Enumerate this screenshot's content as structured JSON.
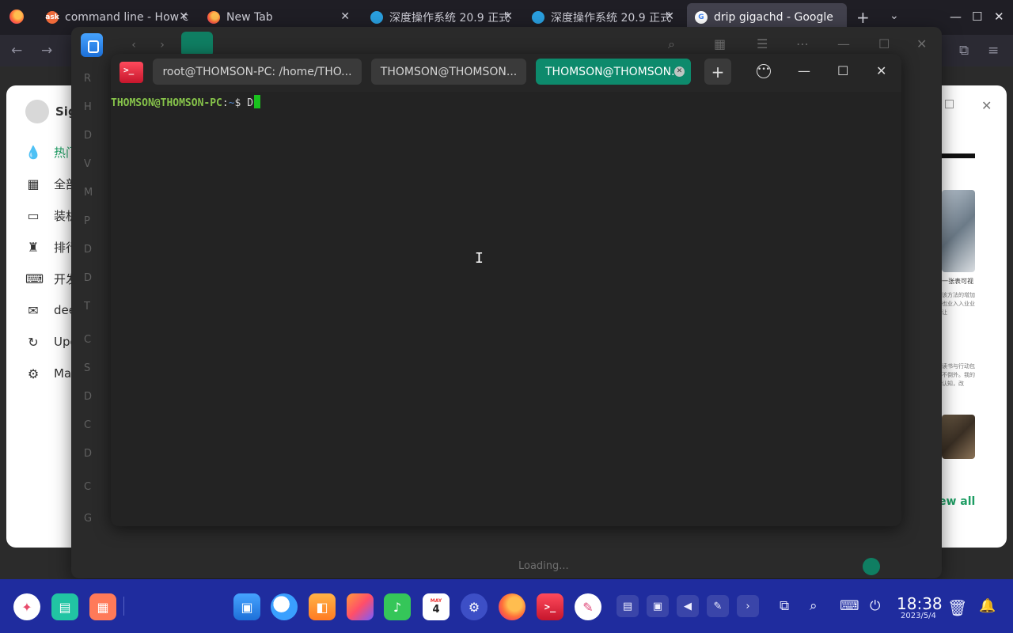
{
  "browser": {
    "tabs": [
      {
        "label": "command line - How c",
        "favicon": "ask",
        "active": false
      },
      {
        "label": "New Tab",
        "favicon": "firefox",
        "active": false
      },
      {
        "label": "深度操作系统 20.9 正式",
        "favicon": "deepin",
        "active": false
      },
      {
        "label": "深度操作系统 20.9 正式",
        "favicon": "deepin",
        "active": false
      },
      {
        "label": "drip gigachd - Google",
        "favicon": "google",
        "active": true
      }
    ],
    "ask_favicon_text": "ask",
    "google_favicon_text": "G",
    "icons": {
      "new_tab": "plus-icon",
      "list_tabs": "chevron-down-icon",
      "back": "arrow-left-icon",
      "forward": "arrow-right-icon",
      "extensions": "puzzle-icon",
      "menu": "hamburger-icon"
    }
  },
  "background_page": {
    "sign_in_label": "Sig",
    "sidebar": [
      {
        "label": "热门",
        "icon": "flame-icon",
        "highlighted": true
      },
      {
        "label": "全部",
        "icon": "grid-icon",
        "highlighted": false
      },
      {
        "label": "装机",
        "icon": "monitor-icon",
        "highlighted": false
      },
      {
        "label": "排行",
        "icon": "trophy-icon",
        "highlighted": false
      },
      {
        "label": "开发",
        "icon": "terminal-icon",
        "highlighted": false
      },
      {
        "label": "dee",
        "icon": "chat-icon",
        "highlighted": false
      },
      {
        "label": "Upd",
        "icon": "refresh-icon",
        "highlighted": false
      },
      {
        "label": "Ma",
        "icon": "gear-icon",
        "highlighted": false
      }
    ],
    "right_texts": [
      "一张表可视",
      "该方法的增加也业入入业业让",
      "读书与行动包不倒外。我的认知，改"
    ],
    "view_all": "ew all"
  },
  "file_manager": {
    "sidebar_letters": [
      "R",
      "H",
      "D",
      "V",
      "M",
      "P",
      "D",
      "D",
      "T",
      "C",
      "S",
      "D",
      "C",
      "D",
      "C",
      "G"
    ],
    "loading_text": "Loading..."
  },
  "terminal": {
    "tabs": [
      {
        "label": "root@THOMSON-PC: /home/THO...",
        "active": false
      },
      {
        "label": "THOMSON@THOMSON...",
        "active": false
      },
      {
        "label": "THOMSON@THOMSON...",
        "active": true
      }
    ],
    "prompt_user": "THOMSON@THOMSON-PC",
    "prompt_sep": ":",
    "prompt_path": "~",
    "prompt_symbol": "$ ",
    "input_text": "D",
    "colors": {
      "accent": "#0d8a6c",
      "user": "#86c34a",
      "path": "#4f7fbf",
      "cursor": "#19c21e"
    }
  },
  "dock": {
    "apps": [
      "launcher-icon",
      "multitask-icon",
      "app-store-icon",
      "file-manager-icon",
      "browser-icon",
      "app-center-icon",
      "image-viewer-icon",
      "music-icon",
      "calendar-icon",
      "settings-icon",
      "firefox-icon",
      "terminal-icon",
      "draw-icon"
    ],
    "calendar_day": "4",
    "calendar_month": "MAY",
    "clock_time": "18:38",
    "clock_date": "2023/5/4",
    "accent": "#1f2c9e"
  }
}
